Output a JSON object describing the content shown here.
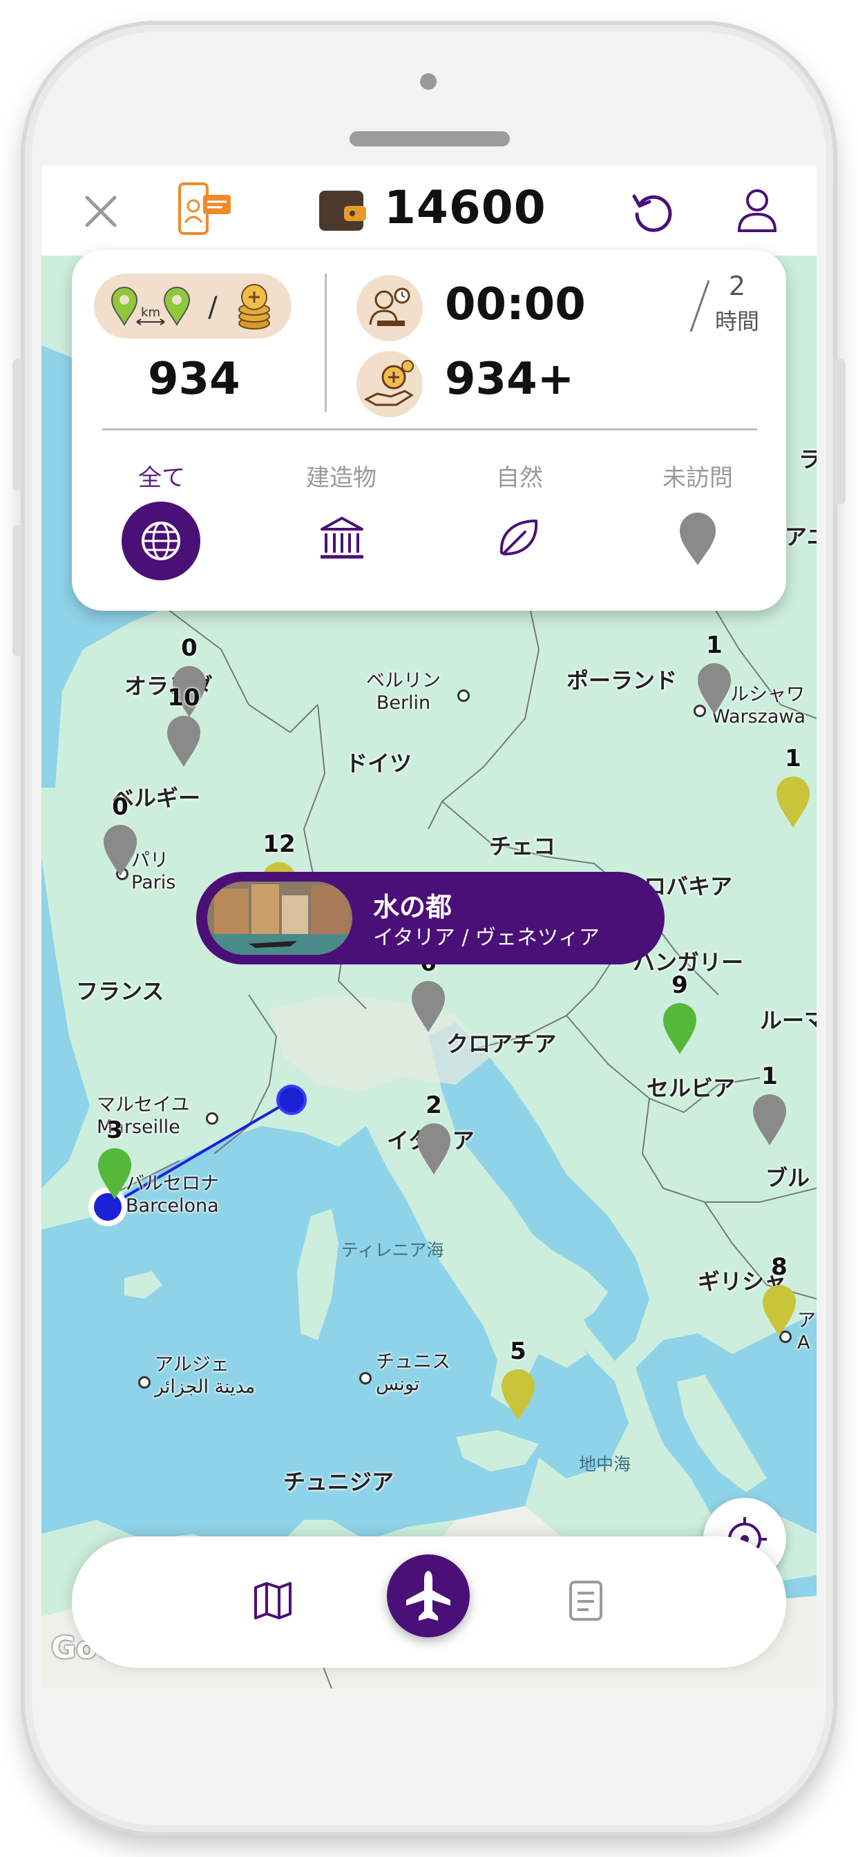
{
  "header": {
    "balance": "14600",
    "icons": [
      "close-icon",
      "support-chat-icon",
      "wallet-icon",
      "refresh-icon",
      "user-icon"
    ]
  },
  "stats": {
    "distance_cost_value": "934",
    "time_value": "00:00",
    "reward_value": "934+",
    "time_limit_number": "2",
    "time_limit_unit": "時間",
    "separator": "/"
  },
  "filters": [
    {
      "label": "全て",
      "icon": "globe-icon",
      "active": true
    },
    {
      "label": "建造物",
      "icon": "building-icon",
      "active": false
    },
    {
      "label": "自然",
      "icon": "leaf-icon",
      "active": false
    },
    {
      "label": "未訪問",
      "icon": "pin-icon",
      "active": false
    }
  ],
  "popup": {
    "title": "水の都",
    "subtitle": "イタリア / ヴェネツィア"
  },
  "map": {
    "countries": [
      "オランダ",
      "ベルギー",
      "ドイツ",
      "ポーランド",
      "チェコ",
      "スロバキア",
      "ハンガリー",
      "フランス",
      "クロアチア",
      "ルーマ",
      "セルビア",
      "イタリア",
      "ブル",
      "ギリシャ",
      "チュニジア",
      "アニ",
      "ラ"
    ],
    "cities": [
      {
        "ja": "ベルリン",
        "en": "Berlin"
      },
      {
        "ja": "ワルシャワ",
        "en": "Warszawa"
      },
      {
        "ja": "パリ",
        "en": "Paris"
      },
      {
        "ja": "マルセイユ",
        "en": "Marseille"
      },
      {
        "ja": "バルセロナ",
        "en": "Barcelona"
      },
      {
        "ja": "アルジェ",
        "en": "مدينة الجزائر"
      },
      {
        "ja": "チュニス",
        "en": "تونس"
      },
      {
        "ja": "ア",
        "en": "A"
      }
    ],
    "seas": [
      "ティレニア海",
      "地中海"
    ],
    "pins": [
      {
        "count": "0",
        "color": "#8a8a8a"
      },
      {
        "count": "10",
        "color": "#8a8a8a"
      },
      {
        "count": "0",
        "color": "#8a8a8a"
      },
      {
        "count": "12",
        "color": "#c9c43a"
      },
      {
        "count": "1",
        "color": "#8a8a8a"
      },
      {
        "count": "1",
        "color": "#c9c43a"
      },
      {
        "count": "6",
        "color": "#8a8a8a"
      },
      {
        "count": "9",
        "color": "#55b83a"
      },
      {
        "count": "2",
        "color": "#8a8a8a"
      },
      {
        "count": "3",
        "color": "#55b83a"
      },
      {
        "count": "1",
        "color": "#8a8a8a"
      },
      {
        "count": "8",
        "color": "#c9c43a"
      },
      {
        "count": "5",
        "color": "#c9c43a"
      }
    ],
    "attribution": "Goo",
    "route": {
      "from": "バルセロナ",
      "to": "水の都"
    }
  },
  "bottom_nav": {
    "items": [
      "map-icon",
      "plane-icon",
      "document-icon"
    ]
  },
  "colors": {
    "accent": "#4a1078",
    "route": "#1a22d6",
    "land": "#cdeedd",
    "sea": "#8fd3e8"
  }
}
